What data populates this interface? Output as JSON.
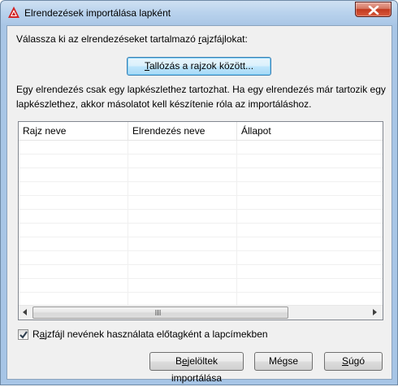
{
  "window": {
    "title": "Elrendezések importálása lapként"
  },
  "instructions": {
    "select_label_before": "Válassza ki az elrendezéseket tartalmazó ",
    "select_label_accel": "r",
    "select_label_after": "ajzfájlokat:",
    "info_line1": "Egy elrendezés csak egy lapkészlethez tartozhat. Ha egy elrendezés már tartozik egy",
    "info_line2": "lapkészlethez, akkor másolatot kell készítenie róla az importáláshoz."
  },
  "browse_button": {
    "label_accel": "T",
    "label_rest": "allózás a rajzok között..."
  },
  "table": {
    "columns": [
      "Rajz neve",
      "Elrendezés neve",
      "Állapot"
    ],
    "rows": []
  },
  "checkbox": {
    "checked": true,
    "label_before": "R",
    "label_accel": "a",
    "label_after": "jzfájl nevének használata előtagként a lapcímekben"
  },
  "footer": {
    "import_before": "B",
    "import_accel": "e",
    "import_after": "jelöltek importálása",
    "cancel_label": "Mégse",
    "help_accel": "S",
    "help_rest": "úgó"
  },
  "icons": {
    "app": "autocad-logo-icon",
    "close": "close-icon",
    "scroll_left": "scroll-left-arrow-icon",
    "scroll_right": "scroll-right-arrow-icon",
    "grip": "scroll-grip-icon",
    "check": "checkmark-icon"
  },
  "colors": {
    "title_bar": "#b5cfec",
    "close_button": "#c7432a",
    "dialog_background": "#f0f0f0",
    "focus_border": "#3c7fb1"
  }
}
